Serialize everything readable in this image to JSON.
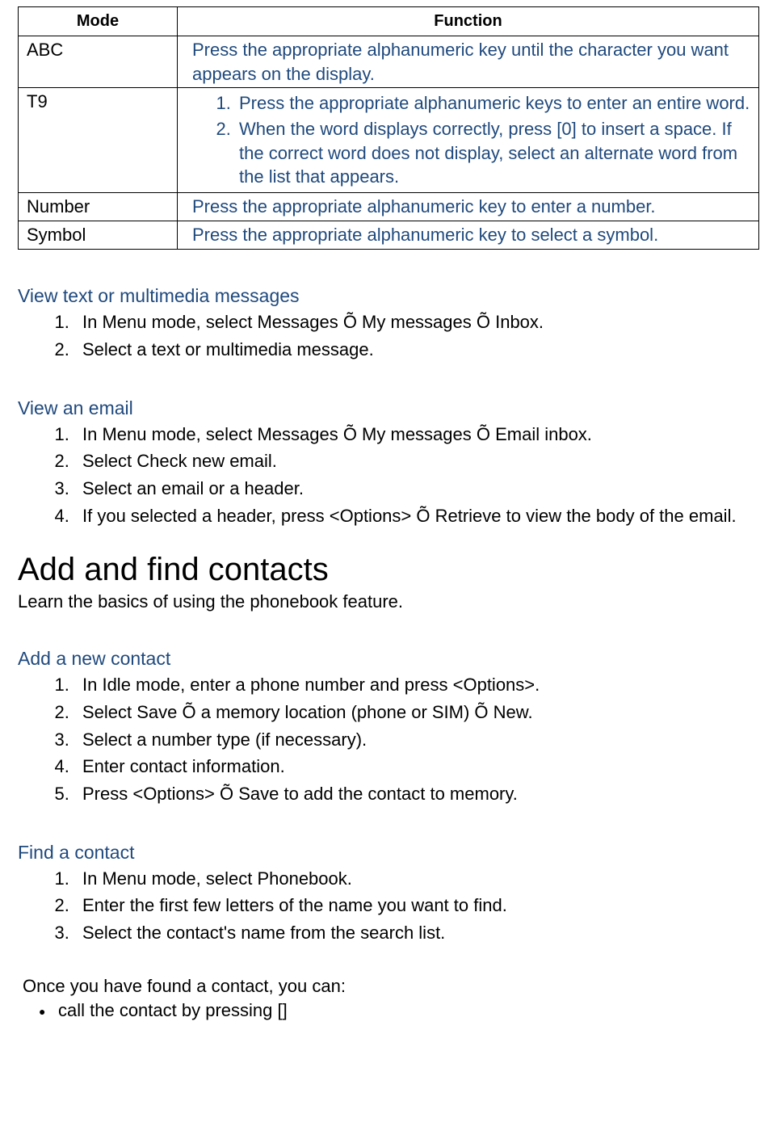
{
  "table": {
    "headers": {
      "mode": "Mode",
      "function": "Function"
    },
    "rows": [
      {
        "mode": "ABC",
        "func_text": "Press the appropriate alphanumeric key until the character you want appears on the display."
      },
      {
        "mode": "T9",
        "func_list": [
          "Press the appropriate alphanumeric keys to enter an entire word.",
          "When the word displays correctly, press [0] to insert a space. If the correct word does not display, select an alternate word from the list that appears."
        ]
      },
      {
        "mode": "Number",
        "func_text": "Press the appropriate alphanumeric key to enter a number."
      },
      {
        "mode": "Symbol",
        "func_text": "Press the appropriate alphanumeric key to select a symbol."
      }
    ]
  },
  "sections": {
    "view_msg": {
      "title": "View text or multimedia messages",
      "steps": [
        "In Menu mode, select Messages Õ My messages Õ Inbox.",
        "Select a text or multimedia message."
      ]
    },
    "view_email": {
      "title": "View an email",
      "steps": [
        "In Menu mode, select Messages Õ My messages Õ Email inbox.",
        "Select Check new email.",
        "Select an email or a header.",
        "If you selected a header, press <Options> Õ Retrieve to view the body of the email."
      ]
    },
    "contacts_heading": "Add and find contacts",
    "contacts_sub": "Learn the basics of using the phonebook feature.",
    "add_contact": {
      "title": "Add a new contact",
      "steps": [
        "In Idle mode, enter a phone number and press <Options>.",
        "Select Save Õ a memory location (phone or SIM) Õ New.",
        "Select a number type (if necessary).",
        "Enter contact information.",
        "Press <Options> Õ Save to add the contact to memory."
      ]
    },
    "find_contact": {
      "title": "Find a contact",
      "steps": [
        "In Menu mode, select Phonebook.",
        "Enter the first few letters of the name you want to find.",
        "Select the contact's name from the search list."
      ]
    },
    "found_text": "Once you have found a contact, you can:",
    "found_bullets": [
      "call the contact by pressing []"
    ]
  }
}
